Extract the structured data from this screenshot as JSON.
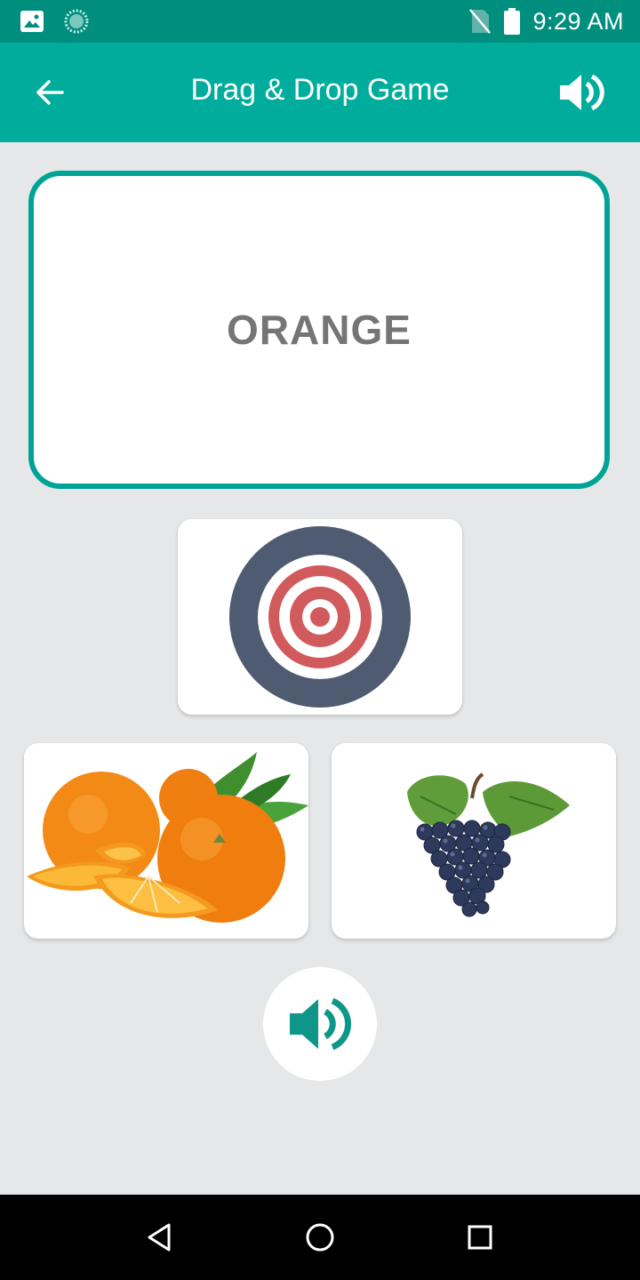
{
  "status_bar": {
    "time": "9:29 AM",
    "icons": [
      "image-icon",
      "loading-icon",
      "no-sim-icon",
      "battery-icon"
    ]
  },
  "app_bar": {
    "title": "Drag & Drop Game",
    "back_icon": "arrow-left-icon",
    "sound_icon": "speaker-icon"
  },
  "game": {
    "word": "ORANGE",
    "target_icon": "target-icon",
    "choices": [
      {
        "name": "orange",
        "icon": "orange-fruit-image"
      },
      {
        "name": "grapes",
        "icon": "grapes-fruit-image"
      }
    ],
    "sound_button_icon": "speaker-icon"
  },
  "nav_bar": {
    "buttons": [
      "back-triangle-icon",
      "home-circle-icon",
      "recents-square-icon"
    ]
  },
  "colors": {
    "status_bar": "#008f7e",
    "app_bar": "#00ad9c",
    "accent_border": "#00a496",
    "background": "#e6e7e8",
    "word_text": "#757575",
    "speaker_teal": "#0e9688"
  }
}
